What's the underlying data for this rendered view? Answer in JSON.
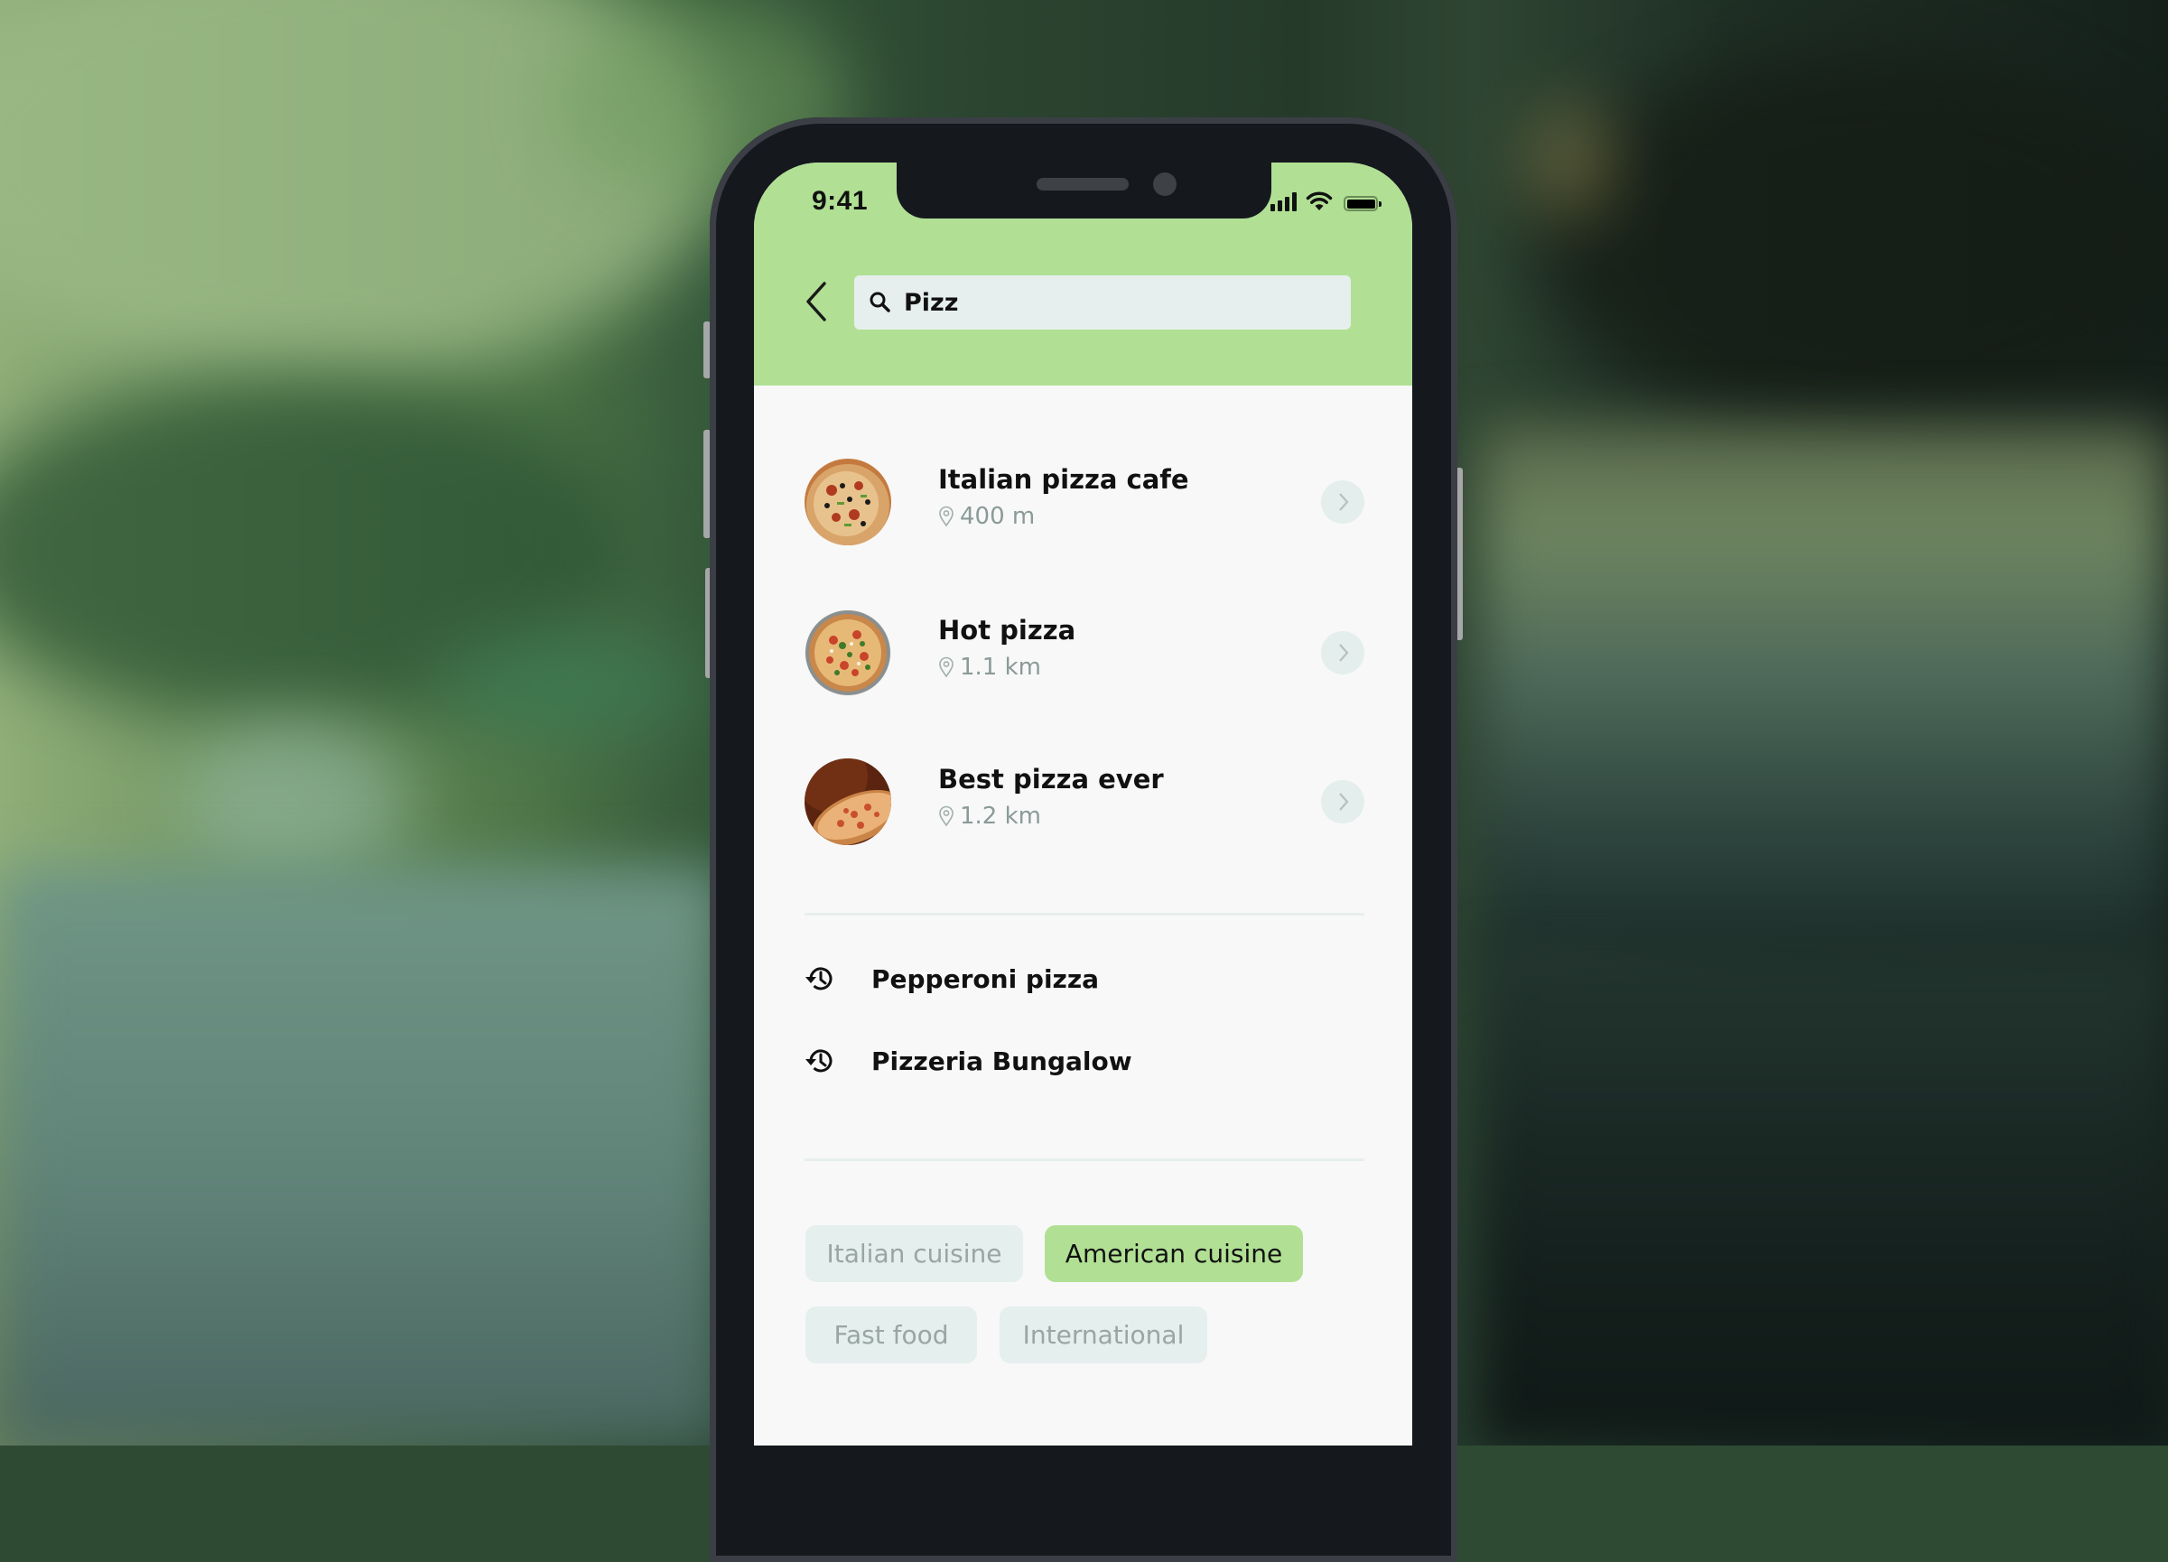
{
  "status_bar": {
    "time": "9:41",
    "icons": [
      "cellular-signal-icon",
      "wifi-icon",
      "battery-icon"
    ]
  },
  "search": {
    "back_icon": "chevron-left-icon",
    "search_icon": "magnifier-icon",
    "value": "Pizz",
    "placeholder": ""
  },
  "results": [
    {
      "title": "Italian pizza cafe",
      "distance": "400 m",
      "thumb": "pizza-slice-photo",
      "pin_icon": "location-pin-icon",
      "chevron_icon": "chevron-right-icon"
    },
    {
      "title": "Hot pizza",
      "distance": "1.1 km",
      "thumb": "pizza-topdown-photo",
      "pin_icon": "location-pin-icon",
      "chevron_icon": "chevron-right-icon"
    },
    {
      "title": "Best pizza ever",
      "distance": "1.2 km",
      "thumb": "pizza-angled-photo",
      "pin_icon": "location-pin-icon",
      "chevron_icon": "chevron-right-icon"
    }
  ],
  "recent_searches": [
    {
      "label": "Pepperoni pizza",
      "icon": "history-icon"
    },
    {
      "label": "Pizzeria Bungalow",
      "icon": "history-icon"
    }
  ],
  "categories": [
    {
      "label": "Italian cuisine",
      "active": false
    },
    {
      "label": "American cuisine",
      "active": true
    },
    {
      "label": "Fast food",
      "active": false
    },
    {
      "label": "International",
      "active": false
    }
  ],
  "colors": {
    "accent_green": "#b1e094",
    "chip_bg": "#e5efed",
    "muted_text": "#8a9a98",
    "screen_bg": "#f8f8f8",
    "phone_body": "#15181d"
  }
}
